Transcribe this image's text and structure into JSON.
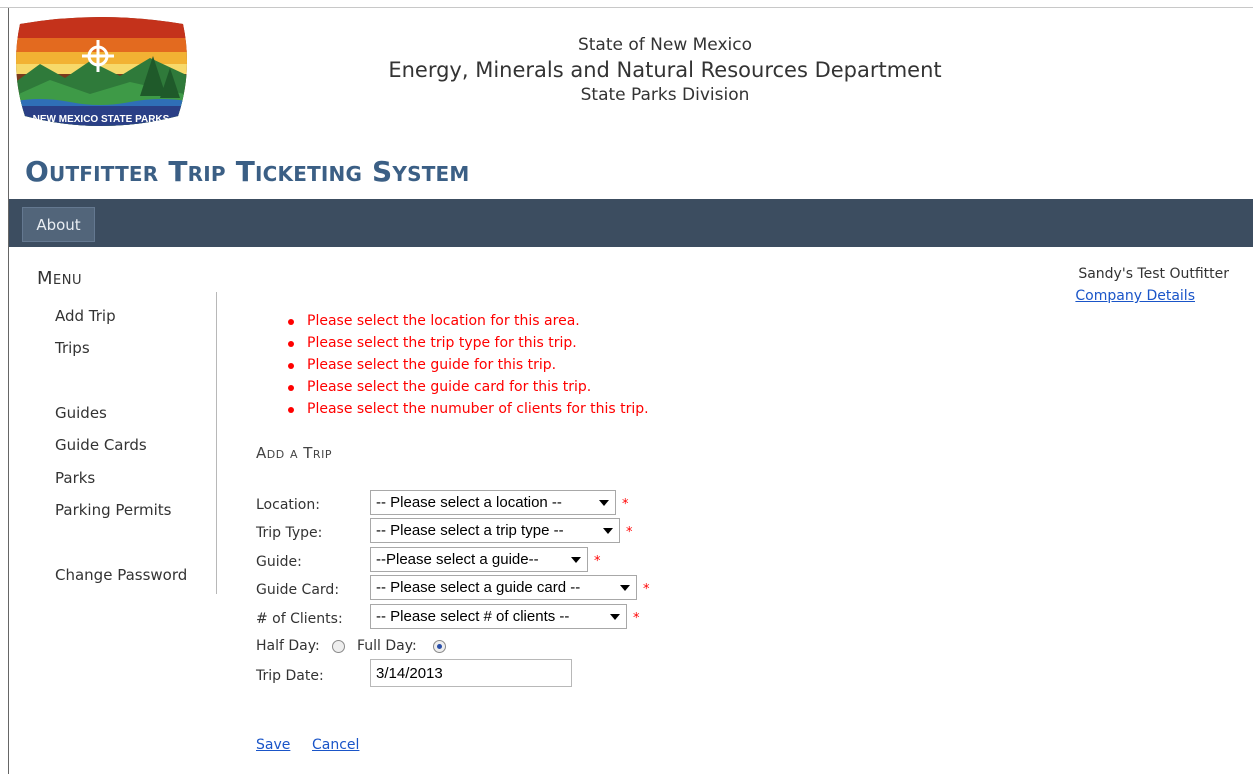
{
  "header": {
    "logo_text": "NEW MEXICO STATE PARKS",
    "line1": "State of New Mexico",
    "line2": "Energy, Minerals and Natural Resources Department",
    "line3": "State Parks Division",
    "system_title": "Outfitter Trip Ticketing System"
  },
  "nav": {
    "about_label": "About"
  },
  "sidebar": {
    "title": "Menu",
    "items": [
      {
        "label": "Add Trip"
      },
      {
        "label": "Trips"
      },
      {
        "label": "Guides"
      },
      {
        "label": "Guide Cards"
      },
      {
        "label": "Parks"
      },
      {
        "label": "Parking Permits"
      },
      {
        "label": "Change Password"
      }
    ]
  },
  "user": {
    "name": "Sandy's Test Outfitter",
    "company_link": "Company Details"
  },
  "errors": [
    "Please select the location for this area.",
    "Please select the trip type for this trip.",
    "Please select the guide for this trip.",
    "Please select the guide card for this trip.",
    "Please select the numuber of clients for this trip."
  ],
  "form": {
    "title": "Add a Trip",
    "location_label": "Location:",
    "location_value": "-- Please select a location --",
    "trip_type_label": "Trip Type:",
    "trip_type_value": "-- Please select a trip type --",
    "guide_label": "Guide:",
    "guide_value": "--Please select a guide--",
    "guide_card_label": "Guide Card:",
    "guide_card_value": "-- Please select a guide card --",
    "clients_label": "# of Clients:",
    "clients_value": "-- Please select # of clients --",
    "required_mark": "*",
    "half_day_label": "Half Day:",
    "full_day_label": "Full Day:",
    "day_selected": "full",
    "trip_date_label": "Trip Date:",
    "trip_date_value": "3/14/2013",
    "save_label": "Save",
    "cancel_label": "Cancel"
  },
  "colors": {
    "navbar": "#3c4d60",
    "title_blue": "#3b5f85",
    "error_red": "#ff0000",
    "link_blue": "#1a55c8"
  }
}
